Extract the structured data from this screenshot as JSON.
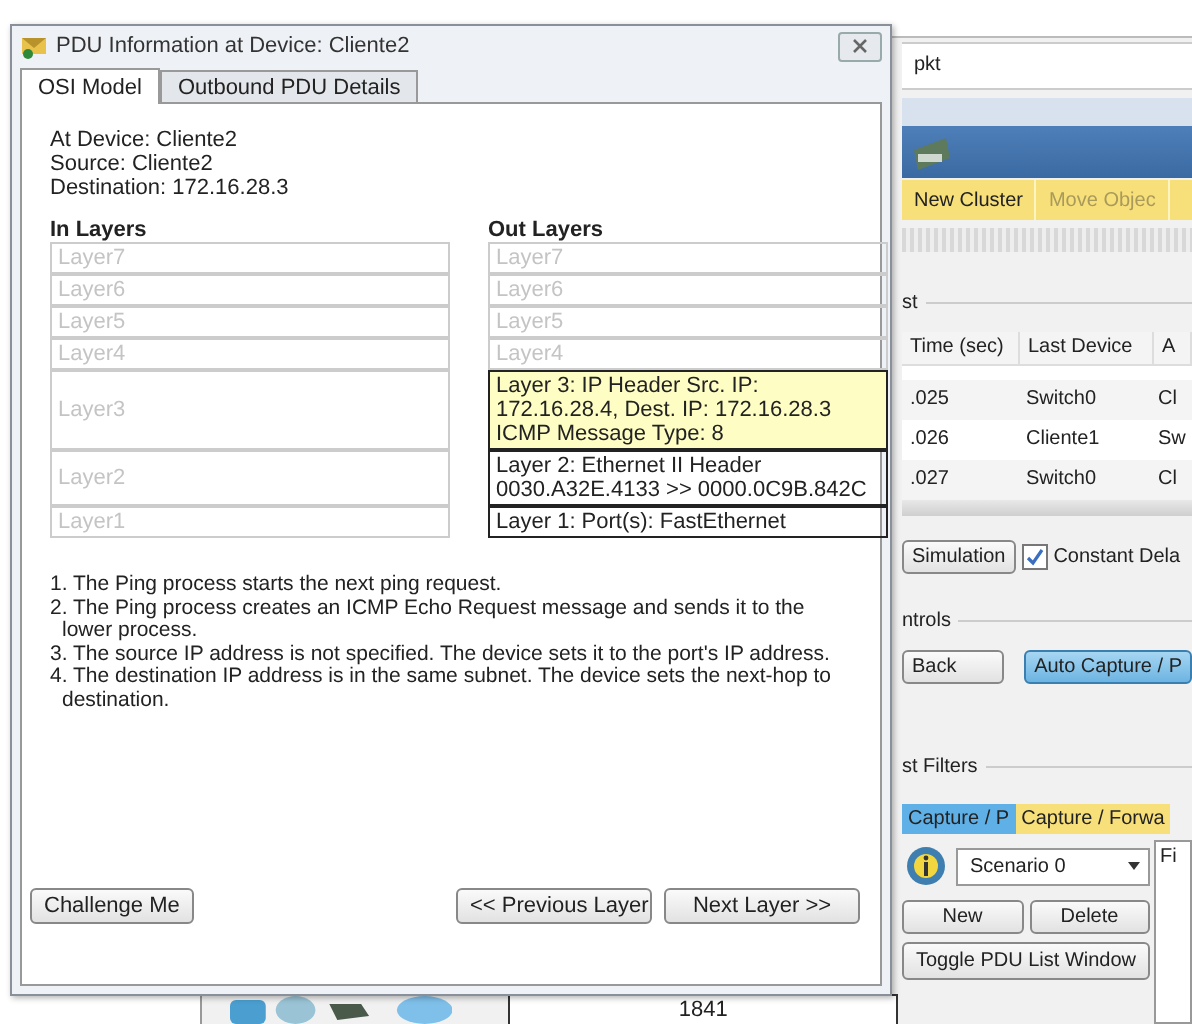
{
  "dialog": {
    "title": "PDU Information at Device: Cliente2",
    "tabs": [
      {
        "label": "OSI Model",
        "selected": true
      },
      {
        "label": "Outbound PDU Details",
        "selected": false
      }
    ],
    "info": [
      "At Device: Cliente2",
      "Source: Cliente2",
      "Destination: 172.16.28.3"
    ],
    "in_heading": "In Layers",
    "out_heading": "Out Layers",
    "layers": [
      {
        "in": {
          "lines": [
            "Layer7"
          ],
          "active": false
        },
        "out": {
          "lines": [
            "Layer7"
          ],
          "active": false,
          "selected": false
        }
      },
      {
        "in": {
          "lines": [
            "Layer6"
          ],
          "active": false
        },
        "out": {
          "lines": [
            "Layer6"
          ],
          "active": false,
          "selected": false
        }
      },
      {
        "in": {
          "lines": [
            "Layer5"
          ],
          "active": false
        },
        "out": {
          "lines": [
            "Layer5"
          ],
          "active": false,
          "selected": false
        }
      },
      {
        "in": {
          "lines": [
            "Layer4"
          ],
          "active": false
        },
        "out": {
          "lines": [
            "Layer4"
          ],
          "active": false,
          "selected": false
        }
      },
      {
        "in": {
          "lines": [
            "Layer3"
          ],
          "active": false
        },
        "out": {
          "lines": [
            "Layer 3: IP Header Src. IP:",
            "172.16.28.4, Dest. IP: 172.16.28.3",
            "ICMP Message Type: 8"
          ],
          "active": true,
          "selected": true
        }
      },
      {
        "in": {
          "lines": [
            "Layer2"
          ],
          "active": false
        },
        "out": {
          "lines": [
            "Layer 2: Ethernet II Header",
            "0030.A32E.4133 >> 0000.0C9B.842C"
          ],
          "active": true,
          "selected": false
        }
      },
      {
        "in": {
          "lines": [
            "Layer1"
          ],
          "active": false
        },
        "out": {
          "lines": [
            "Layer 1: Port(s): FastEthernet"
          ],
          "active": true,
          "selected": false
        }
      }
    ],
    "steps": [
      "1. The Ping process starts the next ping request.",
      "2. The Ping process creates an ICMP Echo Request message and sends it to the lower process.",
      "3. The source IP address is not specified. The device sets it to the port's IP address.",
      "4. The destination IP address is in the same subnet. The device sets the next-hop to destination."
    ],
    "challenge_button": "Challenge Me",
    "prev_button": "<< Previous Layer",
    "next_button": "Next Layer >>"
  },
  "app": {
    "title": "pkt",
    "toolbar": [
      "New Cluster",
      "Move Objec"
    ],
    "event_list": {
      "label": "st",
      "columns": [
        "Time (sec)",
        "Last Device",
        "A"
      ],
      "rows": [
        [
          ".025",
          "Switch0",
          "Cl"
        ],
        [
          ".026",
          "Cliente1",
          "Sw"
        ],
        [
          ".027",
          "Switch0",
          "Cl"
        ]
      ]
    },
    "simulation_button": "Simulation",
    "constant_delay": {
      "label": "Constant Dela",
      "checked": true
    },
    "controls_label": "ntrols",
    "back_button": "Back",
    "auto_capture_button": "Auto Capture / P",
    "filters_label": "st Filters",
    "tabs": [
      {
        "label": "Capture / P",
        "selected": true
      },
      {
        "label": "Capture / Forwa",
        "selected": false
      }
    ],
    "scenario": "Scenario 0",
    "new_button": "New",
    "delete_button": "Delete",
    "toggle_button": "Toggle PDU List Window",
    "side_panel": "Fi",
    "device_cell": "1841"
  }
}
